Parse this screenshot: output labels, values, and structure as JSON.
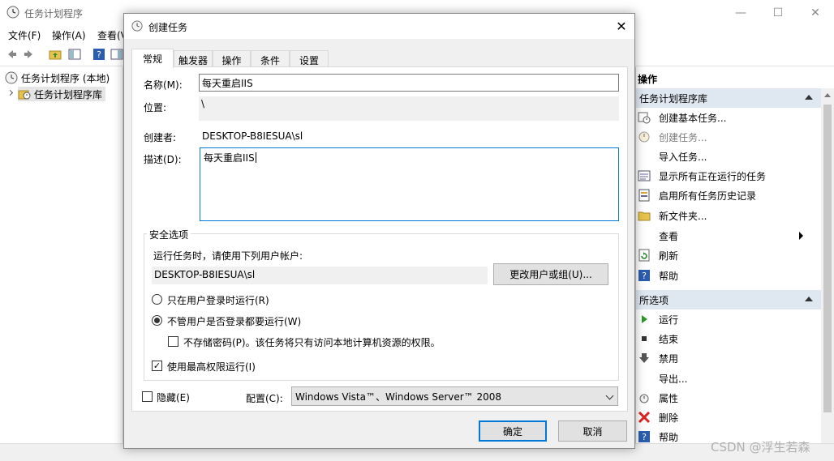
{
  "main": {
    "title": "任务计划程序",
    "menu": [
      "文件(F)",
      "操作(A)",
      "查看(V"
    ],
    "tree": [
      {
        "label": "任务计划程序 (本地)"
      },
      {
        "label": "任务计划程序库"
      }
    ]
  },
  "actions": {
    "header": "操作",
    "section1": "任务计划程序库",
    "items1": [
      {
        "label": "创建基本任务...",
        "icon": "calendar-clock-icon"
      },
      {
        "label": "创建任务...",
        "icon": "clock-icon"
      },
      {
        "label": "导入任务...",
        "icon": ""
      },
      {
        "label": "显示所有正在运行的任务",
        "icon": "task-list-icon"
      },
      {
        "label": "启用所有任务历史记录",
        "icon": "history-icon"
      },
      {
        "label": "新文件夹...",
        "icon": "folder-icon"
      },
      {
        "label": "查看",
        "icon": ""
      },
      {
        "label": "刷新",
        "icon": "refresh-icon"
      },
      {
        "label": "帮助",
        "icon": "help-icon"
      }
    ],
    "section2": "所选项",
    "items2": [
      {
        "label": "运行",
        "icon": "play-icon"
      },
      {
        "label": "结束",
        "icon": "stop-icon"
      },
      {
        "label": "禁用",
        "icon": "disable-icon"
      },
      {
        "label": "导出...",
        "icon": ""
      },
      {
        "label": "属性",
        "icon": "clock-icon"
      },
      {
        "label": "删除",
        "icon": "delete-icon"
      },
      {
        "label": "帮助",
        "icon": "help-icon"
      }
    ]
  },
  "dialog": {
    "title": "创建任务",
    "tabs": [
      "常规",
      "触发器",
      "操作",
      "条件",
      "设置"
    ],
    "name_label": "名称(M):",
    "name_value": "每天重启IIS",
    "location_label": "位置:",
    "location_value": "\\",
    "author_label": "创建者:",
    "author_value": "DESKTOP-B8IESUA\\sl",
    "desc_label": "描述(D):",
    "desc_value": "每天重启IIS",
    "security": {
      "title": "安全选项",
      "run_as_label": "运行任务时，请使用下列用户帐户:",
      "user": "DESKTOP-B8IESUA\\sl",
      "change_user_button": "更改用户或组(U)...",
      "radio_logged_on": "只在用户登录时运行(R)",
      "radio_any": "不管用户是否登录都要运行(W)",
      "no_store_password": "不存储密码(P)。该任务将只有访问本地计算机资源的权限。",
      "highest_privileges": "使用最高权限运行(I)",
      "highest_privileges_checked": true
    },
    "hidden_label": "隐藏(E)",
    "config_label": "配置(C):",
    "config_value": "Windows Vista™、Windows Server™ 2008",
    "ok_button": "确定",
    "cancel_button": "取消"
  },
  "watermark": "CSDN @浮生若森"
}
